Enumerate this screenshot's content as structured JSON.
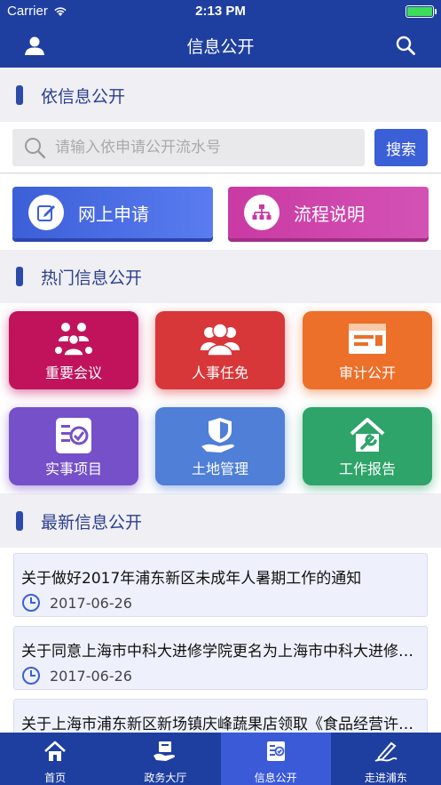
{
  "status": {
    "carrier": "Carrier",
    "time": "2:13 PM",
    "battery_level": 1.0
  },
  "nav": {
    "title": "信息公开",
    "left_icon": "user-icon",
    "right_icon": "search-icon"
  },
  "sections": {
    "apply": "依信息公开",
    "hot": "热门信息公开",
    "latest": "最新信息公开"
  },
  "search": {
    "placeholder": "请输入依申请公开流水号",
    "value": "",
    "button": "搜索"
  },
  "actions": [
    {
      "label": "网上申请",
      "icon": "edit-icon",
      "color": "#3c5fd8"
    },
    {
      "label": "流程说明",
      "icon": "org-chart-icon",
      "color": "#c93aa3"
    }
  ],
  "hot_items": [
    {
      "label": "重要会议",
      "icon": "meeting-icon",
      "color": "#c0135c"
    },
    {
      "label": "人事任免",
      "icon": "personnel-icon",
      "color": "#d8373a"
    },
    {
      "label": "审计公开",
      "icon": "audit-icon",
      "color": "#ec6f2a"
    },
    {
      "label": "实事项目",
      "icon": "project-icon",
      "color": "#7650c9"
    },
    {
      "label": "土地管理",
      "icon": "land-icon",
      "color": "#4f7fd6"
    },
    {
      "label": "工作报告",
      "icon": "report-icon",
      "color": "#2ea36a"
    }
  ],
  "news": [
    {
      "title": "关于做好2017年浦东新区未成年人暑期工作的通知",
      "date": "2017-06-26"
    },
    {
      "title": "关于同意上海市中科大进修学院更名为上海市中科大进修学院的批复",
      "date": "2017-06-26"
    },
    {
      "title": "关于上海市浦东新区新场镇庆峰蔬果店领取《食品经营许可证》的公示",
      "date": ""
    }
  ],
  "tabs": [
    {
      "label": "首页",
      "icon": "home-icon",
      "active": false
    },
    {
      "label": "政务大厅",
      "icon": "service-hall-icon",
      "active": false
    },
    {
      "label": "信息公开",
      "icon": "info-public-icon",
      "active": true
    },
    {
      "label": "走进浦东",
      "icon": "pen-icon",
      "active": false
    }
  ]
}
